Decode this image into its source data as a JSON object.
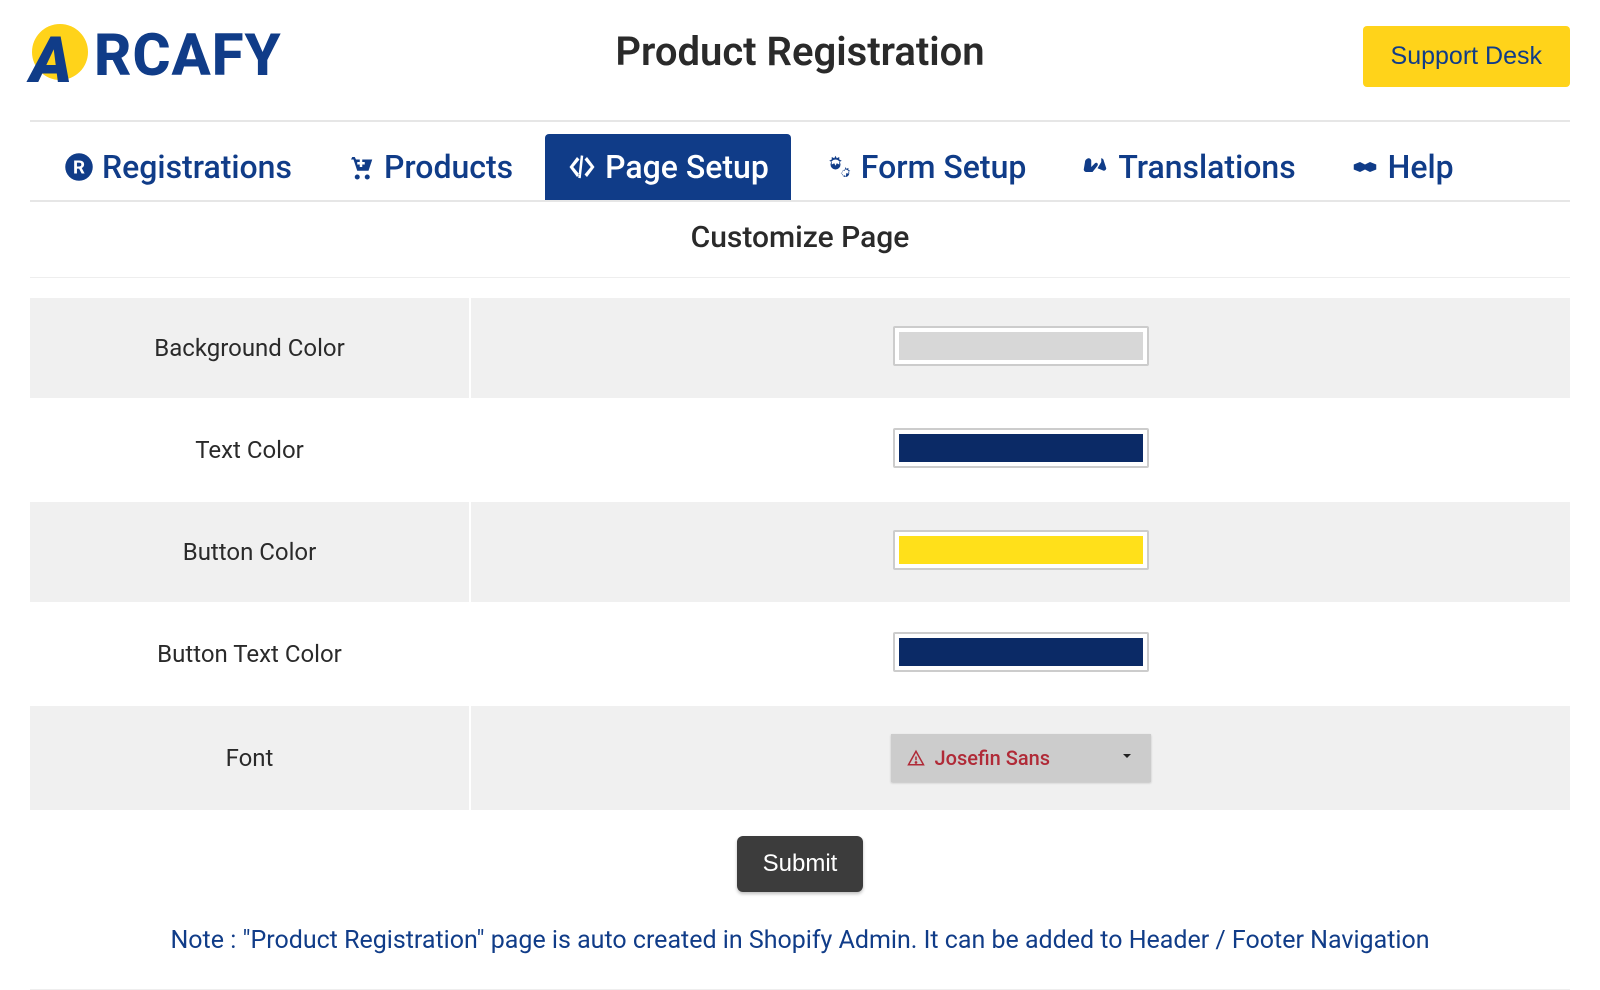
{
  "header": {
    "brand": "RCAFY",
    "page_title": "Product Registration",
    "support_label": "Support Desk"
  },
  "tabs": [
    {
      "label": "Registrations",
      "active": false
    },
    {
      "label": "Products",
      "active": false
    },
    {
      "label": "Page Setup",
      "active": true
    },
    {
      "label": "Form Setup",
      "active": false
    },
    {
      "label": "Translations",
      "active": false
    },
    {
      "label": "Help",
      "active": false
    }
  ],
  "section": {
    "title": "Customize Page"
  },
  "settings": {
    "rows": [
      {
        "label": "Background Color",
        "value": "#d7d7d7"
      },
      {
        "label": "Text Color",
        "value": "#0b2a66"
      },
      {
        "label": "Button Color",
        "value": "#ffe01a"
      },
      {
        "label": "Button Text Color",
        "value": "#0b2a66"
      }
    ],
    "font_row_label": "Font",
    "font_value": "Josefin Sans"
  },
  "actions": {
    "submit_label": "Submit"
  },
  "note_text": "Note : \"Product Registration\" page is auto created in Shopify Admin. It can be added to Header / Footer Navigation"
}
